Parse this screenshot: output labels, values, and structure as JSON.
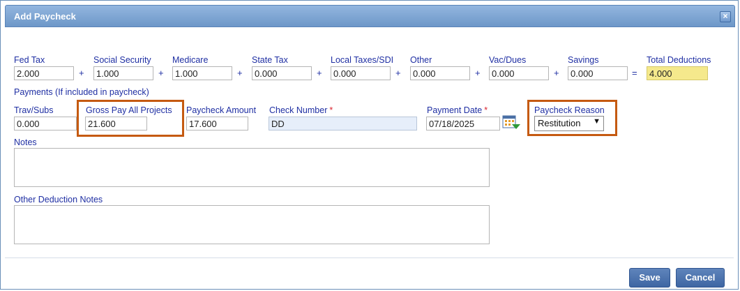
{
  "dialog": {
    "title": "Add Paycheck",
    "close_glyph": "×"
  },
  "deductions": {
    "fed_tax": {
      "label": "Fed Tax",
      "value": "2.000"
    },
    "social_security": {
      "label": "Social Security",
      "value": "1.000"
    },
    "medicare": {
      "label": "Medicare",
      "value": "1.000"
    },
    "state_tax": {
      "label": "State Tax",
      "value": "0.000"
    },
    "local_taxes": {
      "label": "Local Taxes/SDI",
      "value": "0.000"
    },
    "other": {
      "label": "Other",
      "value": "0.000"
    },
    "vac_dues": {
      "label": "Vac/Dues",
      "value": "0.000"
    },
    "savings": {
      "label": "Savings",
      "value": "0.000"
    },
    "total": {
      "label": "Total Deductions",
      "value": "4.000"
    },
    "plus": "+",
    "equals": "="
  },
  "payments": {
    "section_label": "Payments (If included in paycheck)",
    "trav_subs": {
      "label": "Trav/Subs",
      "value": "0.000"
    },
    "gross_pay": {
      "label": "Gross Pay All Projects",
      "value": "21.600"
    },
    "paycheck_amount": {
      "label": "Paycheck Amount",
      "value": "17.600"
    },
    "check_number": {
      "label": "Check Number",
      "value": "DD",
      "required": "*"
    },
    "payment_date": {
      "label": "Payment Date",
      "value": "07/18/2025",
      "required": "*"
    },
    "paycheck_reason": {
      "label": "Paycheck Reason",
      "value": "Restitution"
    }
  },
  "notes": {
    "label": "Notes",
    "value": ""
  },
  "other_deduction_notes": {
    "label": "Other Deduction Notes",
    "value": ""
  },
  "buttons": {
    "save": "Save",
    "cancel": "Cancel"
  },
  "icons": {
    "calendar": "calendar-icon",
    "close": "close-icon",
    "dropdown": "chevron-down-icon"
  },
  "colors": {
    "title_bar": "#7ba2d1",
    "label_text": "#1f2fa3",
    "highlight": "#c55a11",
    "total_bg": "#f5e98c",
    "button": "#4a70ad"
  }
}
